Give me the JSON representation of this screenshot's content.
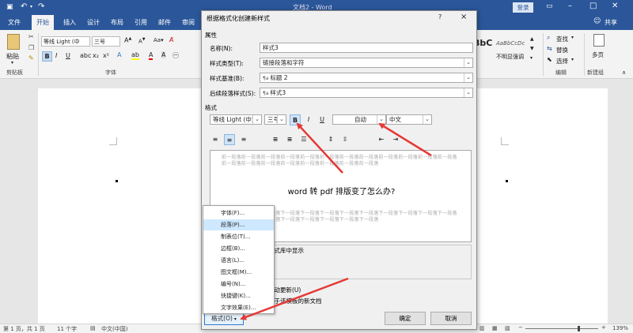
{
  "app": {
    "title": "文档2 - Word",
    "login_label": "登录",
    "share_label": "共享"
  },
  "tabs": [
    "文件",
    "开始",
    "插入",
    "设计",
    "布局",
    "引用",
    "邮件",
    "审阅"
  ],
  "ribbon": {
    "paste_label": "粘贴",
    "clipboard_group": "剪贴板",
    "font_group": "字体",
    "font_name": "等线 Light (中",
    "font_size": "三号",
    "styles_preview": [
      "BbC",
      "AaBbCcDc"
    ],
    "style_name": "不明显强调",
    "find_label": "查找",
    "replace_label": "替换",
    "select_label": "选择",
    "edit_group": "编辑",
    "new_group_btn": "多页",
    "new_group_label": "新建组"
  },
  "dialog": {
    "title": "根据格式化创建新样式",
    "help": "?",
    "close": "×",
    "properties_heading": "属性",
    "name_label": "名称(N):",
    "name_value": "样式3",
    "type_label": "样式类型(T):",
    "type_value": "链接段落和字符",
    "based_label": "样式基准(B):",
    "based_value": "标题 2",
    "next_label": "后续段落样式(S):",
    "next_value": "样式3",
    "format_heading": "格式",
    "font_name": "等线 Light (中文",
    "font_size": "三号",
    "bold": "B",
    "italic": "I",
    "underline": "U",
    "color_value": "自动",
    "lang_value": "中文",
    "preview_prev": "前一段落前一段落前一段落前一段落前一段落前一段落前一段落前一段落前一段落前一段落前一段落前一段落前一段落前一段落前一段落前一段落前一段落前一段落前一段落前一段落",
    "preview_main": "word 转 pdf 排版变了怎么办?",
    "preview_next": "下一段落下一段落下一段落下一段落下一段落下一段落下一段落下一段落下一段落下一段落下一段落下一段落下一段落下一段落下一段落下一段落下一段落下一段落下一段落下一段落",
    "gallery_text": "样式库中显示",
    "auto_update_text": "自动更新(U)",
    "template_text": "基于该模板的新文档",
    "format_button": "格式(O)",
    "ok": "确定",
    "cancel": "取消"
  },
  "menu": [
    "字体(F)...",
    "段落(P)...",
    "制表位(T)...",
    "边框(B)...",
    "语言(L)...",
    "图文框(M)...",
    "编号(N)...",
    "快捷键(K)...",
    "文字效果(E)..."
  ],
  "status": {
    "page": "第 1 页，共 1 页",
    "words": "11 个字",
    "lang": "中文(中国)",
    "zoom": "139%"
  }
}
